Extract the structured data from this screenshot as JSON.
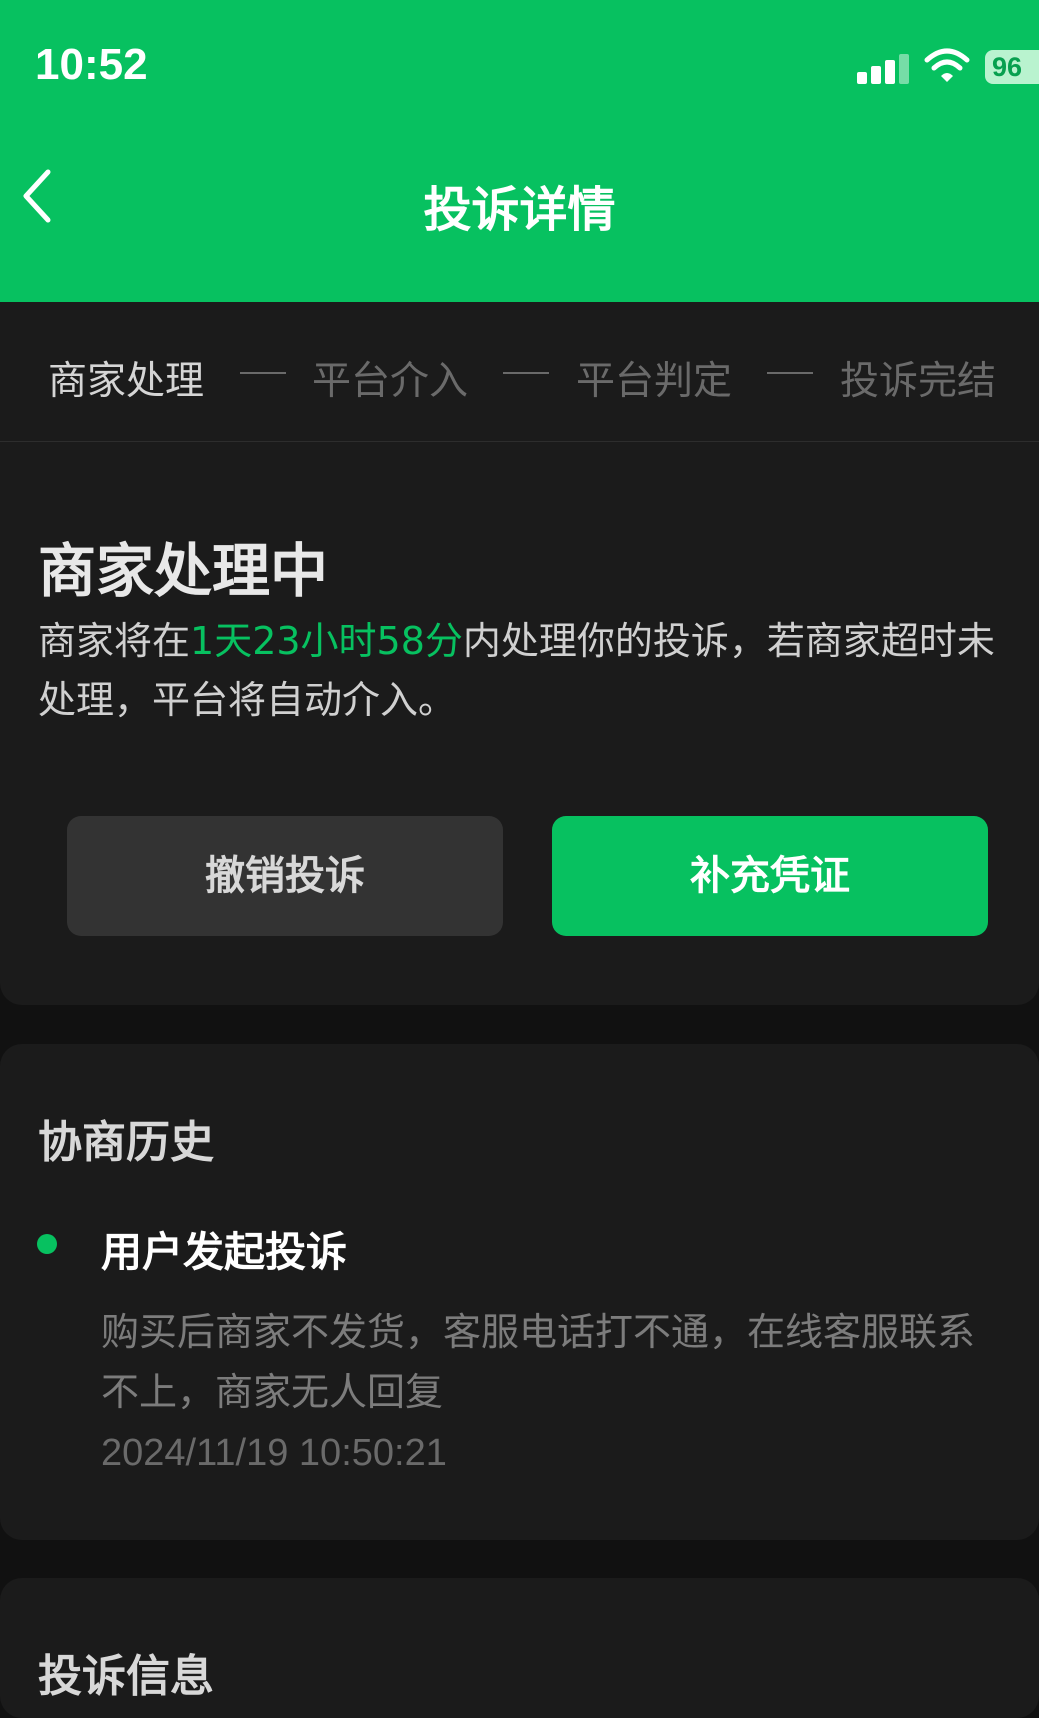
{
  "status_bar": {
    "time": "10:52",
    "battery": "96"
  },
  "nav": {
    "title": "投诉详情",
    "back_icon": "chevron-left-icon"
  },
  "steps": [
    {
      "label": "商家处理",
      "active": true
    },
    {
      "label": "平台介入",
      "active": false
    },
    {
      "label": "平台判定",
      "active": false
    },
    {
      "label": "投诉完结",
      "active": false
    }
  ],
  "status": {
    "title": "商家处理中",
    "desc_prefix": "商家将在",
    "desc_countdown": "1天23小时58分",
    "desc_suffix": "内处理你的投诉，若商家超时未处理，平台将自动介入。",
    "cancel_label": "撤销投诉",
    "evidence_label": "补充凭证"
  },
  "history": {
    "title": "协商历史",
    "events": [
      {
        "title": "用户发起投诉",
        "desc": "购买后商家不发货，客服电话打不通，在线客服联系不上，商家无人回复",
        "time": "2024/11/19 10:50:21"
      }
    ]
  },
  "info": {
    "title": "投诉信息"
  },
  "colors": {
    "accent": "#07c160",
    "background": "#111111",
    "card": "#1b1b1b"
  }
}
